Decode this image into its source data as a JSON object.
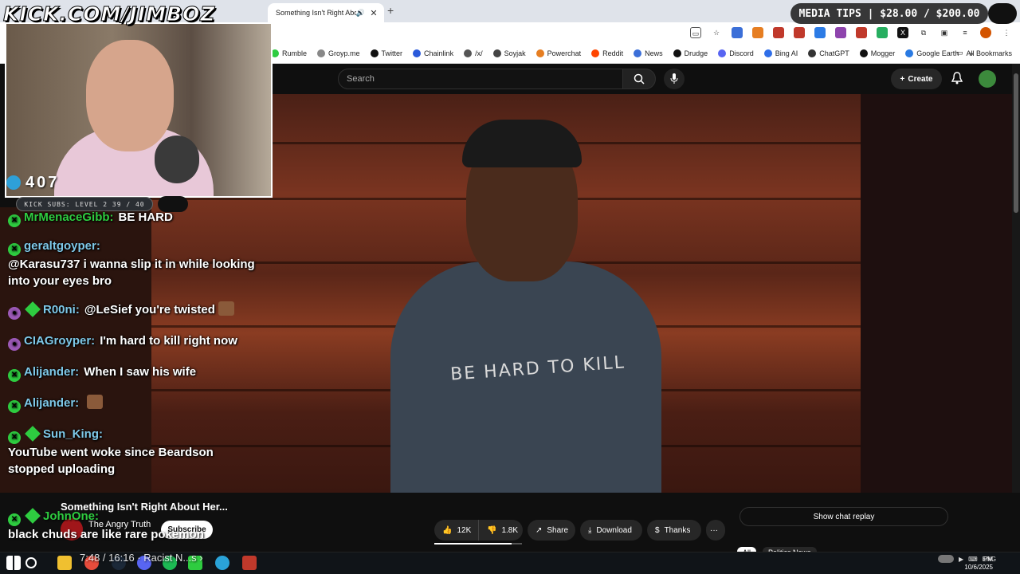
{
  "overlay": {
    "brand": "KICK.COM/JIMBOZ",
    "viewer_count": "407",
    "sub_goal": "KICK SUBS: LEVEL 2 39 / 40",
    "media_tips": "MEDIA TIPS | $28.00 / $200.00"
  },
  "browser": {
    "tab_title": "Something Isn't Right About Her...",
    "bookmarks": [
      "Rumble",
      "Groyp.me",
      "Twitter",
      "Chainlink",
      "/x/",
      "Soyjak",
      "Powerchat",
      "Reddit",
      "News",
      "Drudge",
      "Discord",
      "Bing AI",
      "ChatGPT",
      "Mogger",
      "Google Earth"
    ],
    "bookmarks_more": "»",
    "all_bookmarks": "All Bookmarks"
  },
  "youtube": {
    "search_placeholder": "Search",
    "create_label": "Create",
    "video_title": "Something Isn't Right About Her...",
    "channel_name": "The Angry Truth",
    "subscribe_label": "Subscribe",
    "likes": "12K",
    "dislikes": "1.8K",
    "share_label": "Share",
    "download_label": "Download",
    "thanks_label": "Thanks",
    "more_label": "···",
    "show_chat_replay": "Show chat replay",
    "chips": [
      "All",
      "Politics News"
    ],
    "shirt_text": "BE HARD TO KILL",
    "player_time": "7:48 / 16:16 · Racist N...s ›"
  },
  "chat": {
    "messages": [
      {
        "user": "MrMenaceGibb:",
        "text": "BE HARD"
      },
      {
        "user": "geraltgoyper:",
        "text": "@Karasu737 i wanna slip it in while looking into your eyes bro"
      },
      {
        "user": "R00ni:",
        "text": "@LeSief you're twisted"
      },
      {
        "user": "CIAGroyper:",
        "text": "I'm hard to kill right now"
      },
      {
        "user": "Alijander:",
        "text": "When I saw his wife"
      },
      {
        "user": "Alijander:",
        "text": ""
      },
      {
        "user": "Sun_King:",
        "text": "YouTube went woke since Beardson stopped uploading"
      },
      {
        "user": "JohnOne:",
        "text": "black chuds are like rare pokemon"
      }
    ]
  },
  "taskbar": {
    "lang": "ENG",
    "time": "PM",
    "date": "10/6/2025"
  }
}
